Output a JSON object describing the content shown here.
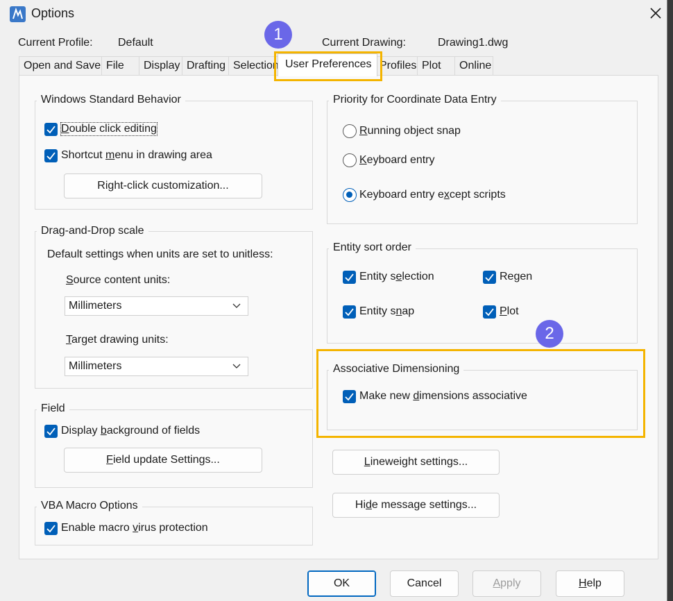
{
  "window": {
    "title": "Options",
    "close_label": "close"
  },
  "header": {
    "profile_label": "Current Profile:",
    "profile_value": "Default",
    "drawing_label": "Current Drawing:",
    "drawing_value": "Drawing1.dwg"
  },
  "tabs": [
    {
      "label": "Open and Save",
      "active": false
    },
    {
      "label": "File",
      "active": false
    },
    {
      "label": "Display",
      "active": false
    },
    {
      "label": "Drafting",
      "active": false
    },
    {
      "label": "Selection",
      "active": false
    },
    {
      "label": "User Preferences",
      "active": true
    },
    {
      "label": "Profiles",
      "active": false
    },
    {
      "label": "Plot",
      "active": false
    },
    {
      "label": "Online",
      "active": false
    }
  ],
  "badges": {
    "one": "1",
    "two": "2"
  },
  "windows_behavior": {
    "title": "Windows Standard Behavior",
    "double_click": {
      "pre": "",
      "key": "D",
      "post": "ouble click editing",
      "checked": true
    },
    "shortcut_menu": {
      "pre": "Shortcut ",
      "key": "m",
      "post": "enu in drawing area",
      "checked": true
    },
    "right_click_btn": {
      "pre": "Ri",
      "key": "g",
      "post": "ht-click customization..."
    }
  },
  "drag_drop": {
    "title": "Drag-and-Drop scale",
    "description": "Default settings when units are set to unitless:",
    "source_label": {
      "key": "S",
      "post": "ource content units:"
    },
    "source_value": "Millimeters",
    "target_label": {
      "key": "T",
      "post": "arget drawing units:"
    },
    "target_value": "Millimeters"
  },
  "field": {
    "title": "Field",
    "display_bg": {
      "pre": "Display ",
      "key": "b",
      "post": "ackground of fields",
      "checked": true
    },
    "update_btn": {
      "key": "F",
      "post": "ield update Settings..."
    }
  },
  "vba": {
    "title": "VBA Macro Options",
    "virus": {
      "pre": "Enable macro ",
      "key": "v",
      "post": "irus protection",
      "checked": true
    }
  },
  "coordinate": {
    "title": "Priority for Coordinate Data Entry",
    "options": [
      {
        "pre": "",
        "key": "R",
        "post": "unning object snap",
        "selected": false
      },
      {
        "pre": "",
        "key": "K",
        "post": "eyboard entry",
        "selected": false
      },
      {
        "pre": "Keyboard entry e",
        "key": "x",
        "post": "cept scripts",
        "selected": true
      }
    ]
  },
  "sort_order": {
    "title": "Entity sort order",
    "entity_selection": {
      "pre": "Entity s",
      "key": "e",
      "post": "lection",
      "checked": true
    },
    "regen": {
      "pre": "Re",
      "key": "g",
      "post": "en",
      "checked": true
    },
    "entity_snap": {
      "pre": "Entity s",
      "key": "n",
      "post": "ap",
      "checked": true
    },
    "plot": {
      "pre": "",
      "key": "P",
      "post": "lot",
      "checked": true
    }
  },
  "assoc": {
    "title": "Associative Dimensioning",
    "make_assoc": {
      "pre": "Make new ",
      "key": "d",
      "post": "imensions associative",
      "checked": true
    }
  },
  "lineweight_btn": {
    "key": "L",
    "post": "ineweight settings..."
  },
  "hide_msg_btn": {
    "pre": "Hi",
    "key": "d",
    "post": "e message settings..."
  },
  "footer": {
    "ok": "OK",
    "cancel": "Cancel",
    "apply": {
      "key": "A",
      "post": "pply"
    },
    "help": {
      "key": "H",
      "post": "elp"
    }
  }
}
